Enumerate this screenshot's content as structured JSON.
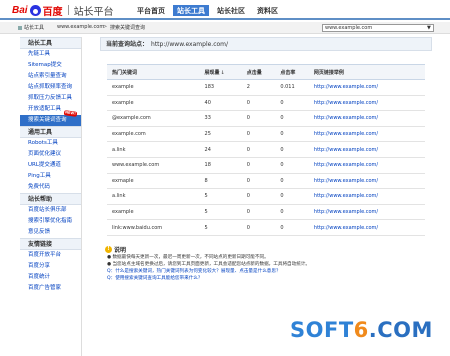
{
  "header": {
    "logo_bai": "Bai",
    "logo_du": "百度",
    "logo_sub": "站长平台",
    "nav": [
      "平台首页",
      "站长工具",
      "站长社区",
      "资料区"
    ],
    "active_nav_index": 1
  },
  "crumb": {
    "home": "站长工具",
    "url": "www.example.com",
    "sep": ">",
    "page": "搜索关键词查询",
    "site_select": "www.example.com"
  },
  "sidebar": {
    "sections": [
      {
        "title": "站长工具",
        "items": [
          "先链工具",
          "Sitemap提交",
          "站点索引量查询",
          "站点抓取频率查询",
          "抓取压力反馈工具",
          "开放适配工具",
          "搜索关键词查询"
        ]
      },
      {
        "title": "通用工具",
        "items": [
          "Robots工具",
          "页面优化建议",
          "URL提交通道",
          "Ping工具",
          "免费代码"
        ]
      },
      {
        "title": "站长帮助",
        "items": [
          "百度站长俱乐部",
          "搜索引擎优化指南",
          "意见反馈"
        ]
      },
      {
        "title": "友情链接",
        "items": [
          "百度开放平台",
          "百度分享",
          "百度统计",
          "百度广告管家"
        ]
      }
    ],
    "active_item": "搜索关键词查询",
    "new_badge": "NEW!"
  },
  "main": {
    "query_label": "当前查询站点：",
    "query_site": "http://www.example.com/",
    "table": {
      "headers": [
        "热门关键词",
        "展现量",
        "点击量",
        "点击率",
        "网页链接举例"
      ],
      "rows": [
        [
          "example",
          "183",
          "2",
          "0.011",
          "http://www.example.com/"
        ],
        [
          "example",
          "40",
          "0",
          "0",
          "http://www.example.com/"
        ],
        [
          "@example.com",
          "33",
          "0",
          "0",
          "http://www.example.com/"
        ],
        [
          "example.com",
          "25",
          "0",
          "0",
          "http://www.example.com/"
        ],
        [
          "a.link",
          "24",
          "0",
          "0",
          "http://www.example.com/"
        ],
        [
          "www.example.com",
          "18",
          "0",
          "0",
          "http://www.example.com/"
        ],
        [
          "exmaple",
          "8",
          "0",
          "0",
          "http://www.example.com/"
        ],
        [
          "a.link",
          "5",
          "0",
          "0",
          "http://www.example.com/"
        ],
        [
          "example",
          "5",
          "0",
          "0",
          "http://www.example.com/"
        ],
        [
          "link:www.baidu.com",
          "5",
          "0",
          "0",
          "http://www.example.com/"
        ]
      ]
    },
    "notes": {
      "title": "说明",
      "lines": [
        "● 数据最快每天更新一次，最迟一周更新一次，不同站点的更新日期可能不同。",
        "● 当您站点主域名更换过后，请您到工具页面更新，工具会适配您站点新的数据，工具将自动统计。",
        "Q：什么是搜索关键词，热门关键词列表为何变化较大？展现量、点击量是什么意思？",
        "Q：使用搜索关键词查询工具能给您带来什么？"
      ]
    }
  },
  "watermark": {
    "part1": "SOFT",
    "part2": "6",
    "part3": ".COM"
  }
}
